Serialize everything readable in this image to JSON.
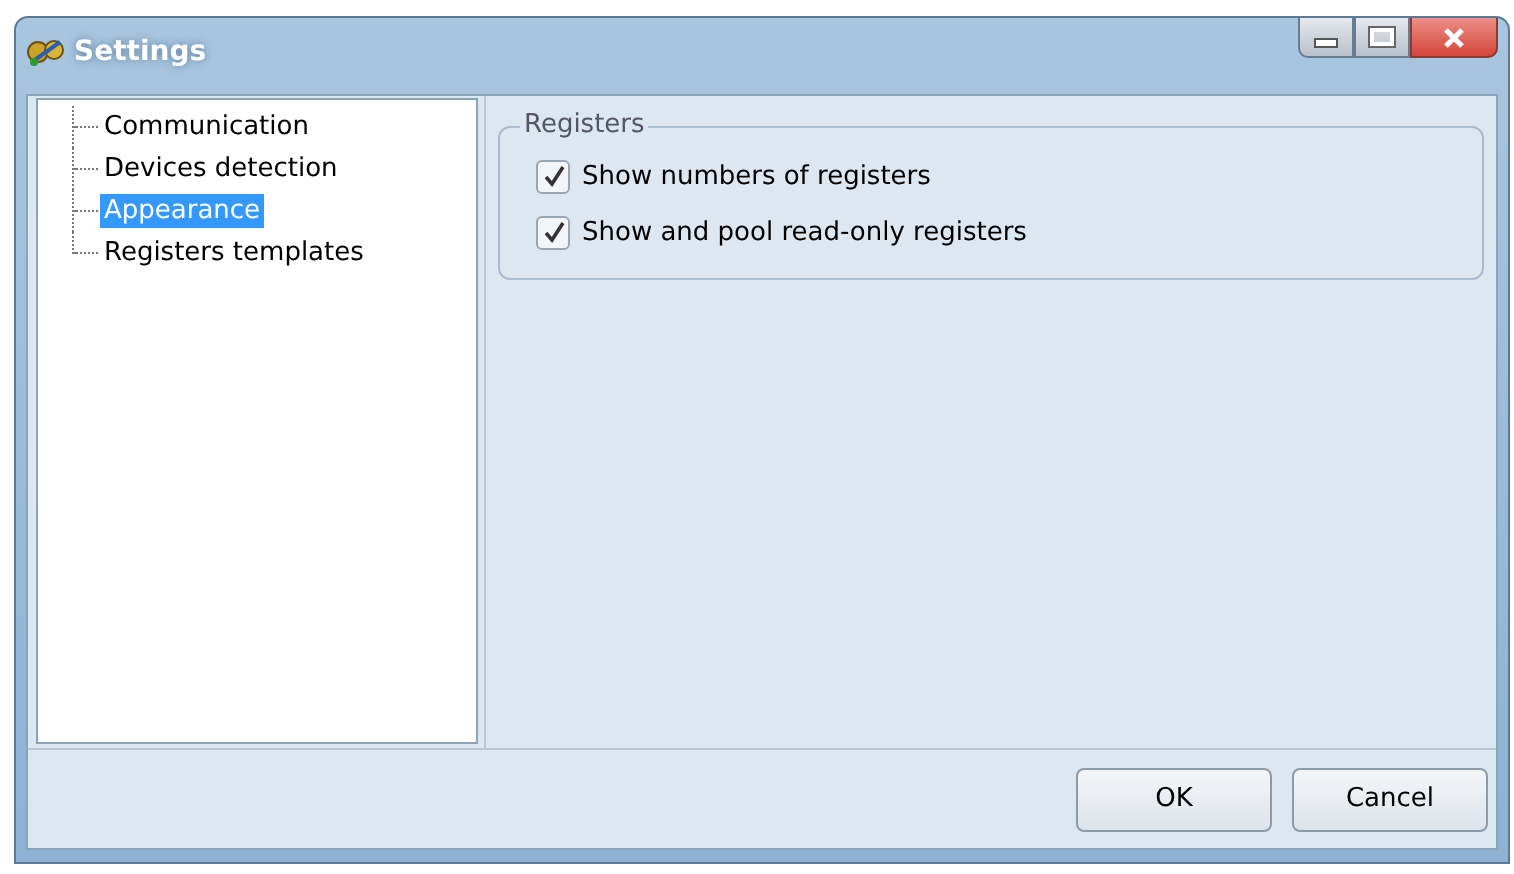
{
  "window": {
    "title": "Settings"
  },
  "tree": {
    "items": [
      {
        "label": "Communication",
        "selected": false
      },
      {
        "label": "Devices detection",
        "selected": false
      },
      {
        "label": "Appearance",
        "selected": true
      },
      {
        "label": "Registers templates",
        "selected": false
      }
    ]
  },
  "group": {
    "title": "Registers",
    "options": [
      {
        "label": "Show numbers of registers",
        "checked": true
      },
      {
        "label": "Show and pool read-only registers",
        "checked": true
      }
    ]
  },
  "buttons": [
    {
      "label": "OK"
    },
    {
      "label": "Cancel"
    }
  ]
}
